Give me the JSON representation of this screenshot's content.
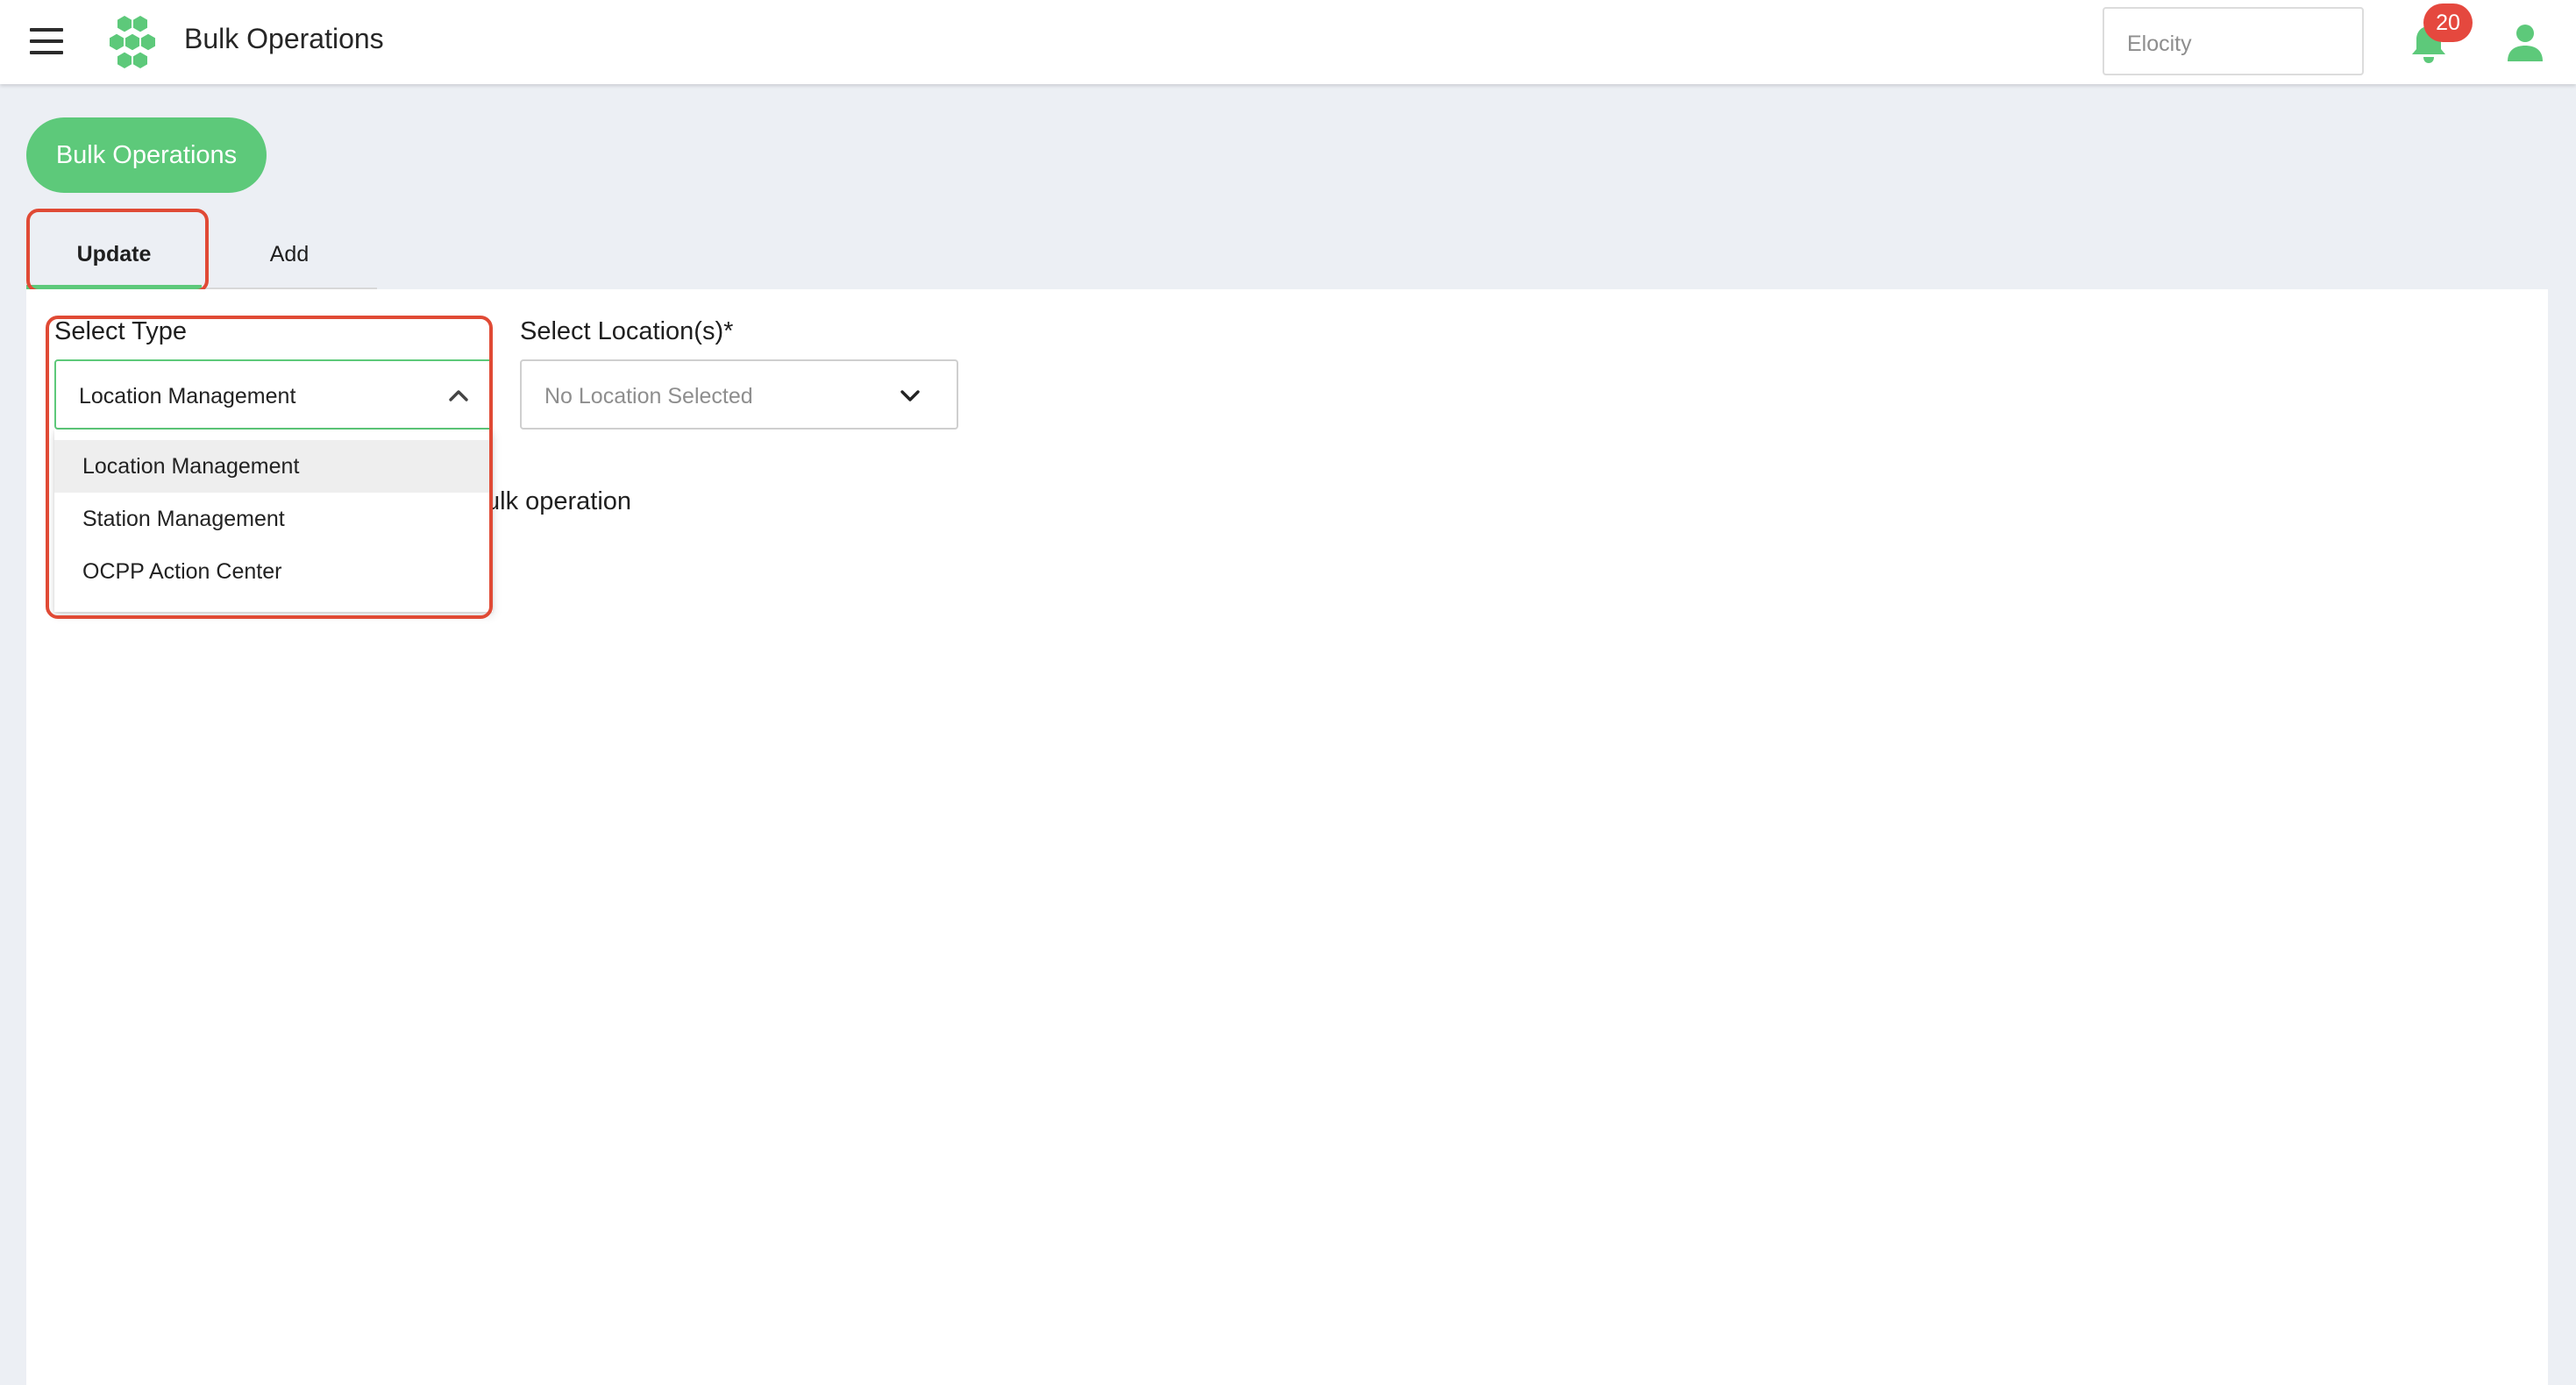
{
  "header": {
    "title": "Bulk Operations",
    "org_select_value": "Elocity",
    "notification_count": "20",
    "menu_icon": "hamburger-menu-icon",
    "logo_icon": "hexagon-cluster-logo-icon",
    "bell_icon": "bell-icon",
    "user_icon": "user-account-icon"
  },
  "page": {
    "pill_button_label": "Bulk Operations",
    "tabs": [
      {
        "label": "Update",
        "active": true
      },
      {
        "label": "Add",
        "active": false
      }
    ]
  },
  "form": {
    "select_type": {
      "label": "Select Type",
      "value": "Location Management",
      "expanded": true,
      "options": [
        "Location Management",
        "Station Management",
        "OCPP Action Center"
      ],
      "selected_index": 0
    },
    "select_location": {
      "label": "Select Location(s)*",
      "placeholder": "No Location Selected"
    },
    "partially_hidden_text": "ulk operation"
  },
  "colors": {
    "accent_green": "#5dc97a",
    "badge_red": "#e5483e",
    "annotation_red": "#e04a35",
    "page_background": "#eceff4"
  }
}
